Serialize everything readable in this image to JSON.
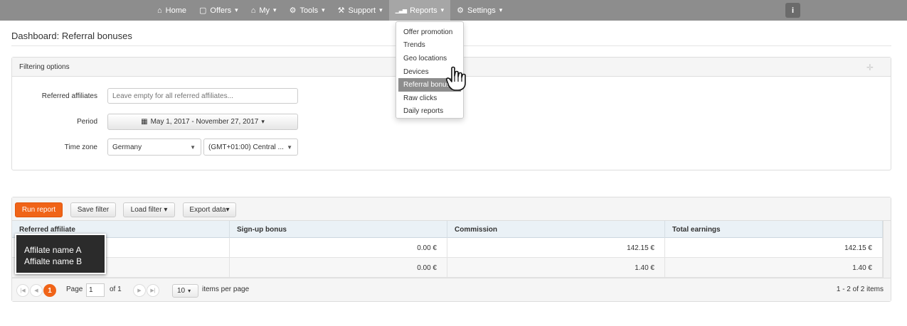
{
  "nav": {
    "items": [
      {
        "icon": "home-icon",
        "glyph": "⌂",
        "label": "Home",
        "caret": ""
      },
      {
        "icon": "offers-icon",
        "glyph": "▢",
        "label": "Offers",
        "caret": "▾"
      },
      {
        "icon": "home-icon",
        "glyph": "⌂",
        "label": "My",
        "caret": "▾"
      },
      {
        "icon": "gear-icon",
        "glyph": "⚙",
        "label": "Tools",
        "caret": "▾"
      },
      {
        "icon": "wrench-icon",
        "glyph": "⚒",
        "label": "Support",
        "caret": "▾"
      },
      {
        "icon": "bar-chart-icon",
        "glyph": "▁▃▅",
        "label": "Reports",
        "caret": "▾"
      },
      {
        "icon": "gear-icon",
        "glyph": "⚙",
        "label": "Settings",
        "caret": "▾"
      }
    ],
    "info_glyph": "i"
  },
  "page": {
    "title": "Dashboard: Referral bonuses"
  },
  "filter": {
    "heading": "Filtering options",
    "plus_glyph": "✛",
    "referred_label": "Referred affiliates",
    "referred_placeholder": "Leave empty for all referred affiliates...",
    "period_label": "Period",
    "period_icon": "▦",
    "period_value": "May 1, 2017 - November 27, 2017",
    "period_caret": "▾",
    "timezone_label": "Time zone",
    "country_value": "Germany",
    "zone_value": "(GMT+01:00) Central ...",
    "select_arrow": "▼"
  },
  "toolbar": {
    "run_report": "Run report",
    "save_filter": "Save filter",
    "load_filter": "Load filter ▾",
    "export_data": "Export data▾"
  },
  "table": {
    "headers": [
      "Referred affiliate",
      "Sign-up bonus",
      "Commission",
      "Total earnings"
    ],
    "rows": [
      {
        "signup": "0.00 €",
        "commission": "142.15 €",
        "total": "142.15 €"
      },
      {
        "signup": "0.00 €",
        "commission": "1.40 €",
        "total": "1.40 €"
      }
    ]
  },
  "tooltip": {
    "line1": "Affilate name A",
    "line2": "Affialte name B"
  },
  "pager": {
    "first": "|◀",
    "prev": "◀",
    "current": "1",
    "next": "▶",
    "last": "▶|",
    "page_label": "Page",
    "page_value": "1",
    "of_label": "of 1",
    "per_page_value": "10",
    "per_page_arrow": "▾",
    "per_page_label": "items per page",
    "summary": "1 - 2 of 2 items"
  },
  "reports_menu": {
    "items": [
      "Offer promotion",
      "Trends",
      "Geo locations",
      "Devices",
      "Referral bonus",
      "Raw clicks",
      "Daily reports"
    ],
    "highlighted_index": 4
  }
}
